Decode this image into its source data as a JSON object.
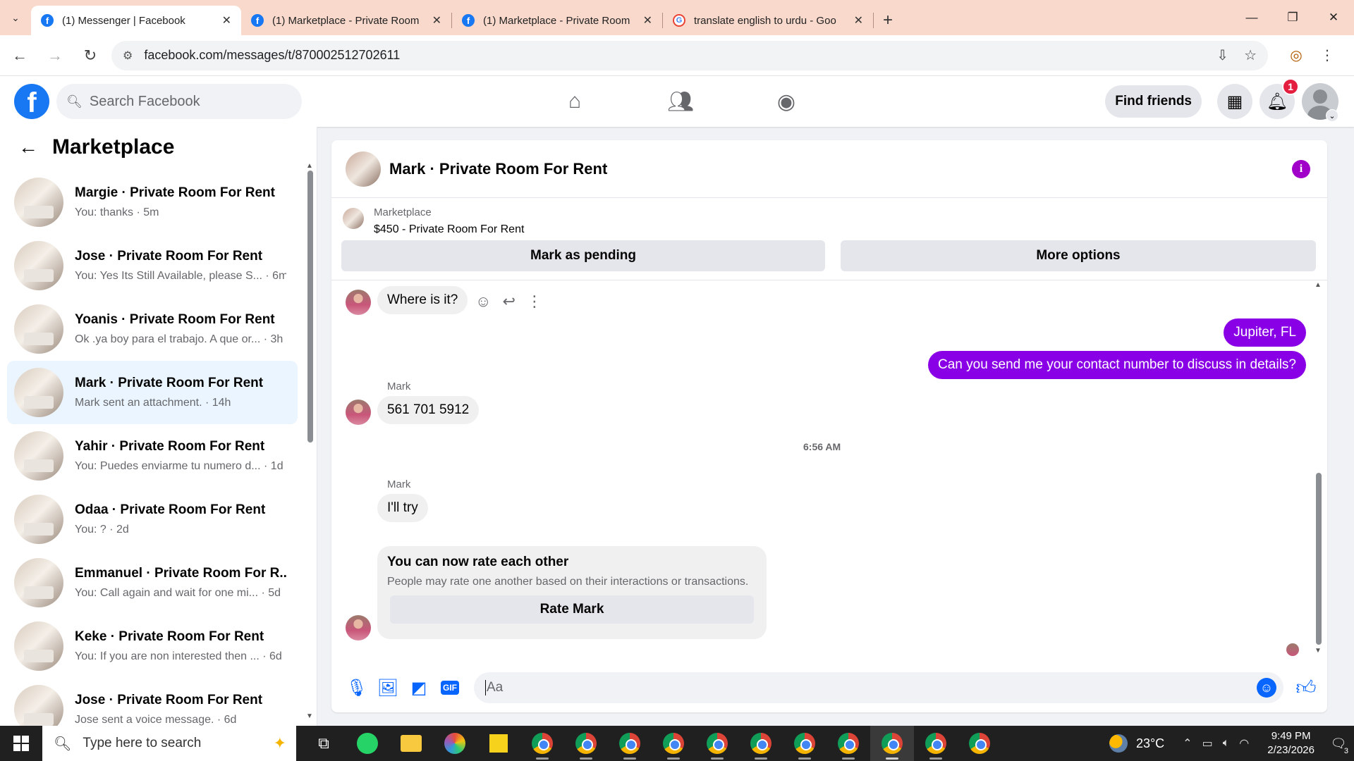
{
  "browser": {
    "tabs": [
      {
        "title": "(1) Messenger | Facebook",
        "icon": "facebook-icon",
        "active": true
      },
      {
        "title": "(1) Marketplace - Private Room",
        "icon": "facebook-icon",
        "active": false
      },
      {
        "title": "(1) Marketplace - Private Room",
        "icon": "facebook-icon",
        "active": false
      },
      {
        "title": "translate english to urdu - Goo",
        "icon": "google-icon",
        "active": false
      }
    ],
    "url": "facebook.com/messages/t/870002512702611"
  },
  "facebook": {
    "logo": "f",
    "search_placeholder": "Search Facebook",
    "find_friends": "Find friends",
    "notification_count": "1"
  },
  "sidebar": {
    "title": "Marketplace",
    "conversations": [
      {
        "name": "Margie · Private Room For Rent",
        "preview": "You: thanks · 5m",
        "selected": false
      },
      {
        "name": "Jose · Private Room For Rent",
        "preview": "You: Yes Its Still Available, please S... · 6m",
        "selected": false
      },
      {
        "name": "Yoanis · Private Room For Rent",
        "preview": "Ok .ya boy para el trabajo. A que or... · 3h",
        "selected": false
      },
      {
        "name": "Mark · Private Room For Rent",
        "preview": "Mark sent an attachment. · 14h",
        "selected": true
      },
      {
        "name": "Yahir · Private Room For Rent",
        "preview": "You: Puedes enviarme tu numero d... · 1d",
        "selected": false
      },
      {
        "name": "Odaa · Private Room For Rent",
        "preview": "You: ? · 2d",
        "selected": false
      },
      {
        "name": "Emmanuel · Private Room For R...",
        "preview": "You: Call again and wait for one mi... · 5d",
        "selected": false
      },
      {
        "name": "Keke · Private Room For Rent",
        "preview": "You: If you are non interested then ... · 6d",
        "selected": false
      },
      {
        "name": "Jose · Private Room For Rent",
        "preview": "Jose sent a voice message. · 6d",
        "selected": false
      }
    ]
  },
  "chat": {
    "title": "Mark · Private Room For Rent",
    "listing": {
      "label": "Marketplace",
      "price_title": "$450 - Private Room For Rent",
      "mark_pending": "Mark as pending",
      "more_options": "More options"
    },
    "messages": {
      "in_1": "Where is it?",
      "out_1": "Jupiter, FL",
      "out_2": "Can you send me your contact number to discuss in details?",
      "sender_1": "Mark",
      "in_2": "561 701 5912",
      "timestamp": "6:56 AM",
      "sender_2": "Mark",
      "in_3": "I'll try"
    },
    "rating": {
      "heading": "You can now rate each other",
      "description": "People may rate one another based on their interactions or transactions.",
      "button": "Rate Mark"
    },
    "composer_placeholder": "Aa"
  },
  "taskbar": {
    "search_placeholder": "Type here to search",
    "temperature": "23°C",
    "time": "9:49 PM",
    "date": "2/23/2026",
    "notification_count": "3"
  },
  "colors": {
    "accent": "#8a00e6",
    "facebook_blue": "#1877f2",
    "messenger_blue": "#0866ff",
    "tab_bar": "#f9d9cc"
  }
}
